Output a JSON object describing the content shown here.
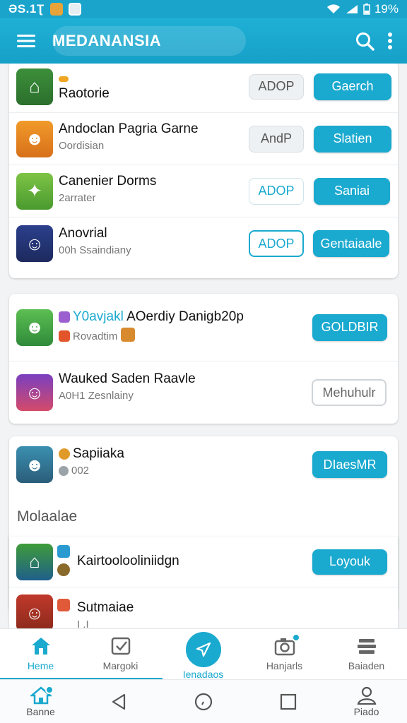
{
  "statusbar": {
    "time": "ƏS.1Ʈ",
    "battery": "19%"
  },
  "appbar": {
    "title": "MEDANANSIA",
    "menu_icon": "hamburger-icon",
    "search_icon": "search-icon",
    "more_icon": "more-vert-icon"
  },
  "colors": {
    "accent": "#1aa9cf",
    "appbar": "#16a0c8",
    "background": "#f1f3f5"
  },
  "card1": {
    "rows": [
      {
        "name": "Raotorie",
        "sub": "",
        "btn1": "ADOP",
        "btn2": "Gaerch"
      },
      {
        "name": "Andoclan Pagria Garne",
        "sub": "Oordisian",
        "btn1": "AndP",
        "btn2": "Slatien"
      },
      {
        "name": "Canenier Dorms",
        "sub": "2arrater",
        "btn1": "ADOP",
        "btn2": "Saniai"
      },
      {
        "name": "Anovrial",
        "sub": "00h Ssaindiany",
        "btn1": "ADOP",
        "btn2": "Gentaiaale"
      }
    ]
  },
  "card2": {
    "rows": [
      {
        "name_a": "Y0avjakl",
        "name_b": "AOerdiy Danigb20p",
        "sub": "Rovadtim",
        "btn": "GOLDBIR"
      },
      {
        "name": "Wauked Saden Raavle",
        "sub": "A0H1 Zesnlainy",
        "btn": "Mehuhulr"
      }
    ]
  },
  "card3": {
    "rows": [
      {
        "name": "Sapiiaka",
        "sub": "002",
        "btn": "DIaesMR"
      }
    ]
  },
  "section_label": "Molaalae",
  "card4": {
    "rows": [
      {
        "name": "Kairtoolooliniidgn",
        "btn": "Loyouk"
      },
      {
        "name": "Sutmaiae",
        "sub": "I .I"
      }
    ]
  },
  "tabs": [
    {
      "label": "Heme",
      "icon": "home-icon"
    },
    {
      "label": "Margoki",
      "icon": "checkbox-icon"
    },
    {
      "label": "Ienadaos",
      "icon": "send-icon"
    },
    {
      "label": "Hanjarls",
      "icon": "camera-icon"
    },
    {
      "label": "Baiaden",
      "icon": "stack-icon"
    }
  ],
  "sysnav": {
    "home_label": "Banne",
    "profile_label": "Piado"
  }
}
